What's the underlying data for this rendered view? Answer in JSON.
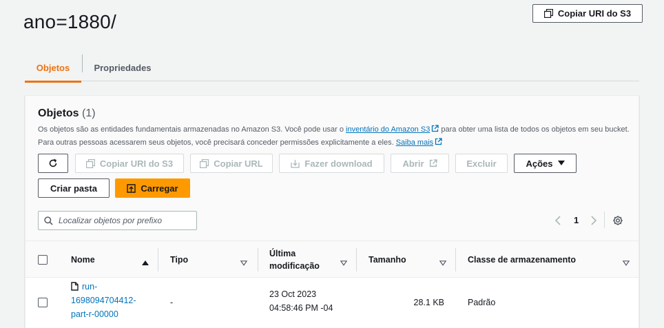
{
  "header": {
    "title": "ano=1880/",
    "copy_uri_button": "Copiar URI do S3"
  },
  "tabs": [
    {
      "label": "Objetos",
      "active": true
    },
    {
      "label": "Propriedades",
      "active": false
    }
  ],
  "objects_panel": {
    "title": "Objetos",
    "count": "(1)",
    "description_line1_prefix": "Os objetos são as entidades fundamentais armazenadas no Amazon S3. Você pode usar o",
    "description_line1_link": "inventário do Amazon S3",
    "description_line1_suffix": "para obter uma lista de todos os objetos em seu bucket.",
    "description_line2_prefix": "Para outras pessoas acessarem seus objetos, você precisará conceder permissões explicitamente a eles.",
    "description_line2_link": "Saiba mais"
  },
  "toolbar": {
    "refresh_icon": "refresh-icon",
    "copy_s3_uri": "Copiar URI do S3",
    "copy_url": "Copiar URL",
    "download": "Fazer download",
    "open": "Abrir",
    "delete": "Excluir",
    "actions": "Ações",
    "create_folder": "Criar pasta",
    "upload": "Carregar"
  },
  "search": {
    "placeholder": "Localizar objetos por prefixo"
  },
  "pagination": {
    "current_page": "1"
  },
  "table": {
    "columns": [
      {
        "label": "Nome",
        "sort": "ascending"
      },
      {
        "label": "Tipo"
      },
      {
        "label": "Última modificação"
      },
      {
        "label": "Tamanho"
      },
      {
        "label": "Classe de armazenamento"
      }
    ],
    "column_modified_line1": "Última",
    "column_modified_line2": "modificação",
    "rows": [
      {
        "name_line1": "run-",
        "name_line2": "1698094704412-",
        "name_line3": "part-r-00000",
        "type": "-",
        "modified_line1": "23 Oct 2023",
        "modified_line2": "04:58:46 PM -04",
        "size": "28.1 KB",
        "storage_class": "Padrão"
      }
    ]
  },
  "colors": {
    "accent_orange": "#ec7211",
    "button_orange": "#ff9900",
    "link_blue": "#0073bb"
  }
}
